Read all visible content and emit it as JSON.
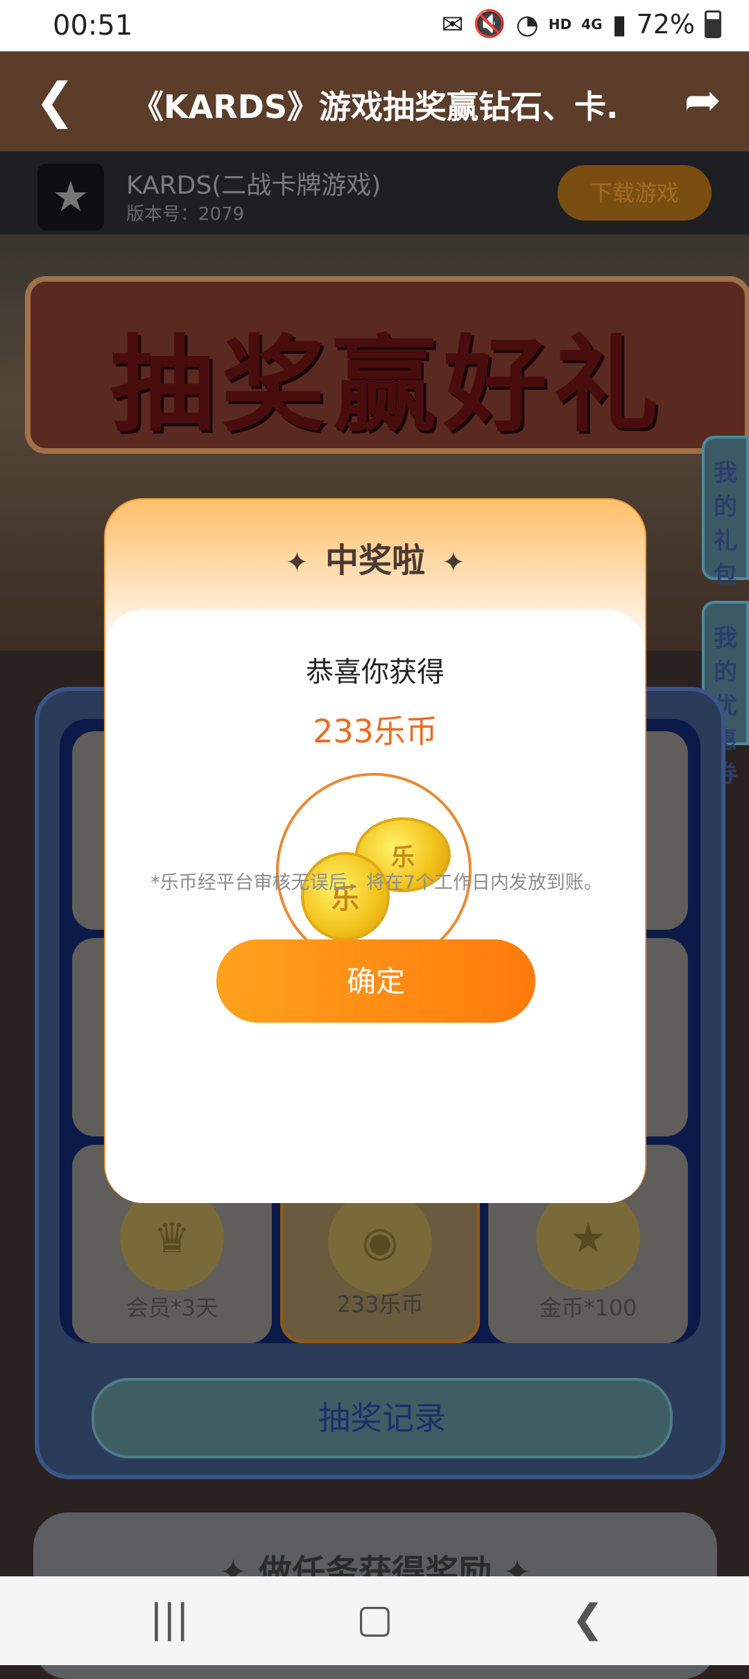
{
  "status_bar": {
    "time": "00:51",
    "network_hd": "HD",
    "network_4g": "4G",
    "battery": "72%"
  },
  "nav": {
    "title": "《KARDS》游戏抽奖赢钻石、卡..."
  },
  "game": {
    "name": "KARDS(二战卡牌游戏)",
    "version": "版本号：2079",
    "download_label": "下载游戏"
  },
  "banner": {
    "title": "抽奖赢好礼"
  },
  "side_tabs": {
    "gift": [
      "我",
      "的",
      "礼",
      "包"
    ],
    "coupon": [
      "我",
      "的",
      "优",
      "惠",
      "券"
    ]
  },
  "prizes": [
    {
      "label": "会员*3天",
      "icon": "crown-icon"
    },
    {
      "label": "233乐币",
      "icon": "coin-stack-icon"
    },
    {
      "label": "金币*100",
      "icon": "gold-coin-icon"
    }
  ],
  "record_button": "抽奖记录",
  "task_panel": {
    "title": "做任务获得奖励"
  },
  "modal": {
    "header": "中奖啦",
    "congrats": "恭喜你获得",
    "prize": "233乐币",
    "coin_char": "乐",
    "notice": "*乐币经平台审核无误后，将在7个工作日内发放到账。",
    "confirm": "确定"
  },
  "colors": {
    "accent": "#ff8a12",
    "prize_text": "#e86c24"
  }
}
